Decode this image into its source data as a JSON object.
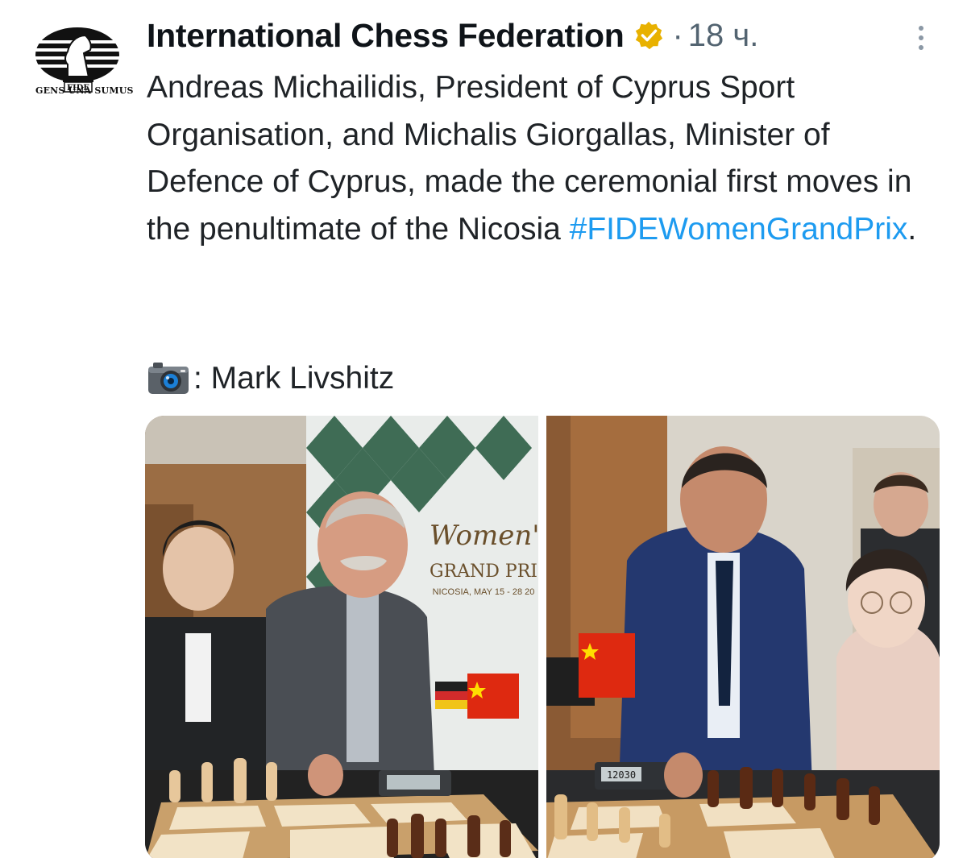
{
  "author": {
    "name": "International Chess Federation",
    "avatar_motto": "GENS UNA SUMUS",
    "avatar_logo_text": "FIDE",
    "verified": true,
    "verified_color": "#e8b100"
  },
  "meta": {
    "separator": "·",
    "timestamp": "18 ч."
  },
  "text": {
    "body": "Andreas Michailidis, President of Cyprus Sport Organisation, and Michalis Giorgallas, Minister of Defence of Cyprus, made the ceremonial first moves in the penultimate of the Nicosia ",
    "hashtag": "#FIDEWomenGrandPrix",
    "ending": ".",
    "credit_label": ": Mark Livshitz",
    "credit_icon": "camera-icon"
  },
  "colors": {
    "hashtag": "#1d9bf0",
    "secondary_text": "#536471"
  },
  "media": {
    "photo_1": {
      "banner_title": "Women's",
      "banner_sub": "GRAND PRI",
      "banner_dates": "NICOSIA, MAY 15 - 28 20"
    },
    "photo_2": {
      "clock": "12030"
    }
  }
}
